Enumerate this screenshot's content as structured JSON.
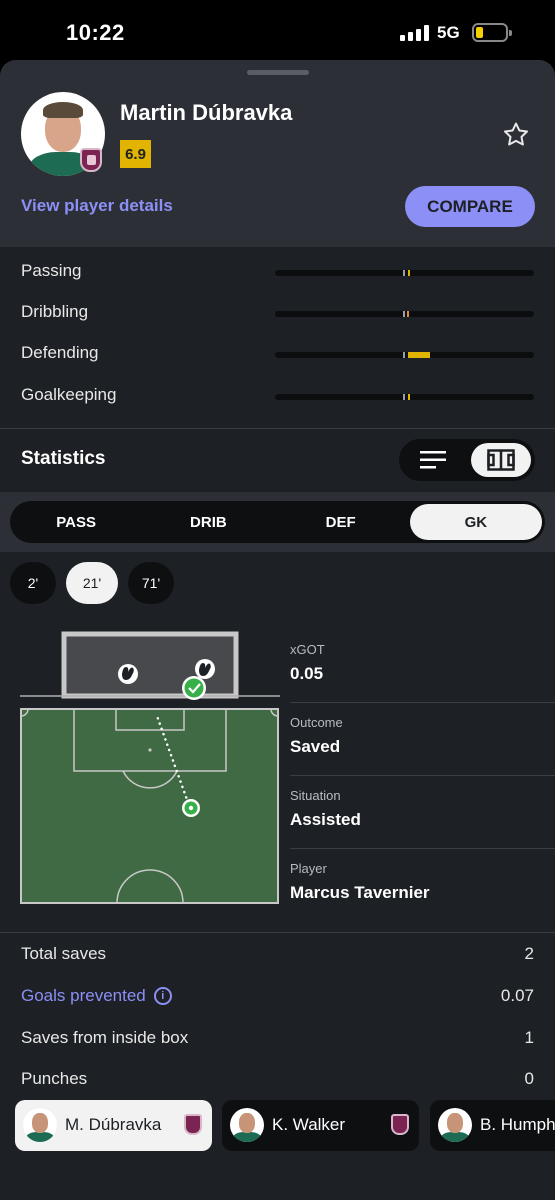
{
  "status_bar": {
    "time": "10:22",
    "network": "5G"
  },
  "player": {
    "name": "Martin Dúbravka",
    "rating": "6.9",
    "rating_color": "#e0b400",
    "view_details_label": "View player details",
    "compare_label": "COMPARE"
  },
  "attributes": [
    {
      "label": "Passing",
      "value": 0.52
    },
    {
      "label": "Dribbling",
      "value": 0.5
    },
    {
      "label": "Defending",
      "value": 0.6
    },
    {
      "label": "Goalkeeping",
      "value": 0.52
    }
  ],
  "statistics": {
    "title": "Statistics",
    "tabs": [
      "PASS",
      "DRIB",
      "DEF",
      "GK"
    ],
    "active_tab": "GK",
    "minutes": [
      "2'",
      "21'",
      "71'"
    ],
    "active_minute": "21'"
  },
  "shot": {
    "xgot_label": "xGOT",
    "xgot_value": "0.05",
    "outcome_label": "Outcome",
    "outcome_value": "Saved",
    "situation_label": "Situation",
    "situation_value": "Assisted",
    "player_label": "Player",
    "player_value": "Marcus Tavernier"
  },
  "summary": [
    {
      "label": "Total saves",
      "value": "2",
      "link": false
    },
    {
      "label": "Goals prevented",
      "value": "0.07",
      "link": true
    },
    {
      "label": "Saves from inside box",
      "value": "1",
      "link": false
    },
    {
      "label": "Punches",
      "value": "0",
      "link": false
    }
  ],
  "player_bar": [
    {
      "name": "M. Dúbravka",
      "active": true
    },
    {
      "name": "K. Walker",
      "active": false
    },
    {
      "name": "B. Humph",
      "active": false
    }
  ],
  "colors": {
    "accent": "#8c8ff5",
    "pitch": "#3f6a43",
    "save_marker": "#37b04a"
  }
}
